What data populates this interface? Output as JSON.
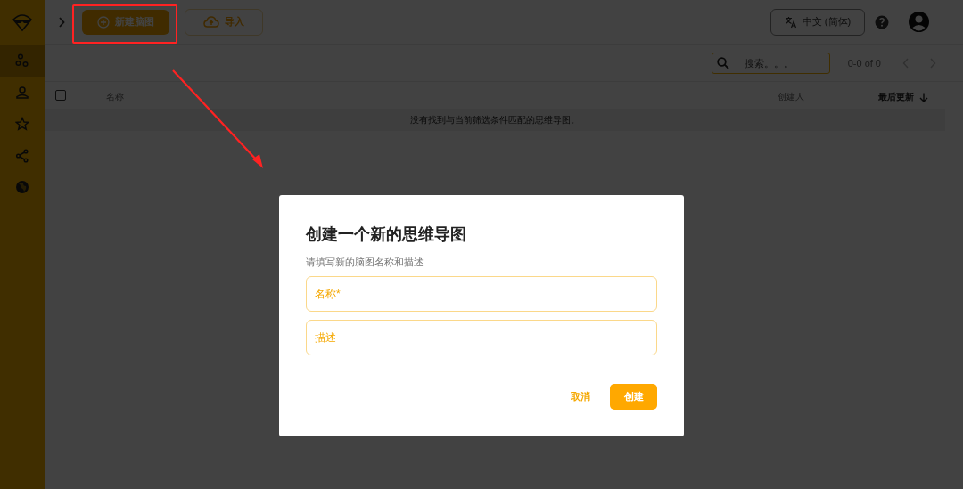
{
  "sidebar": {
    "items": [
      {
        "kind": "mindmap",
        "selected": true
      },
      {
        "kind": "user",
        "selected": false
      },
      {
        "kind": "star",
        "selected": false
      },
      {
        "kind": "share",
        "selected": false
      },
      {
        "kind": "globe",
        "selected": false
      }
    ]
  },
  "top_bar": {
    "new_button": "新建脑图",
    "import_button": "导入",
    "language_button": "中文 (简体)"
  },
  "toolbar": {
    "search": {
      "placeholder": "搜索。。。"
    },
    "pagination": "0-0 of 0"
  },
  "table": {
    "select_all": {
      "checked": false
    },
    "columns": [
      {
        "label": "名称",
        "sorted": false
      },
      {
        "label": "创建人",
        "sorted": false
      },
      {
        "label": "最后更新",
        "sorted": true
      }
    ],
    "empty_message": "没有找到与当前筛选条件匹配的思维导图。"
  },
  "dialog": {
    "title": "创建一个新的思维导图",
    "subtitle": "请填写新的脑图名称和描述",
    "fields": [
      {
        "placeholder": "名称*"
      },
      {
        "placeholder": "描述"
      }
    ],
    "buttons": [
      {
        "label": "取消",
        "kind": "text"
      },
      {
        "label": "创建",
        "kind": "primary"
      }
    ]
  }
}
